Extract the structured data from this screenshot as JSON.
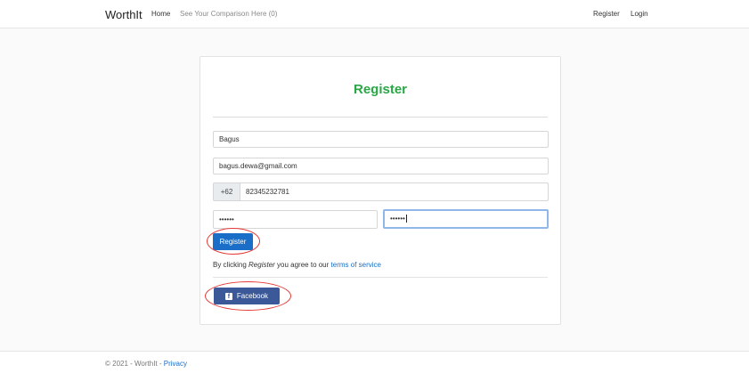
{
  "navbar": {
    "brand": "WorthIt",
    "home": "Home",
    "compare": "See Your Comparison Here (0)",
    "register": "Register",
    "login": "Login"
  },
  "form": {
    "title": "Register",
    "name_value": "Bagus",
    "email_value": "bagus.dewa@gmail.com",
    "phone_prefix": "+62",
    "phone_value": "82345232781",
    "password_value": "••••••",
    "confirm_password_value": "••••••",
    "submit_label": "Register",
    "terms_prefix": "By clicking ",
    "terms_emphasis": "Register",
    "terms_middle": " you agree to our ",
    "terms_link": "terms of service",
    "facebook_label": "Facebook",
    "facebook_icon": "f"
  },
  "footer": {
    "copyright": "© 2021 - WorthIt - ",
    "privacy": "Privacy"
  },
  "colors": {
    "title_green": "#28a745",
    "primary_blue": "#1a6ec7",
    "facebook_blue": "#3b5998",
    "annotation_red": "#e53935"
  }
}
